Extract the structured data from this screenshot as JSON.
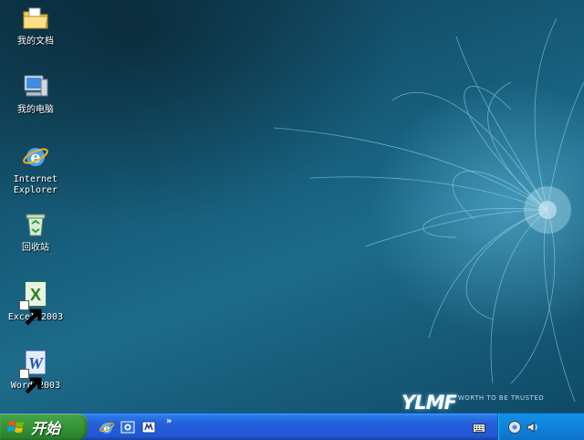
{
  "desktop": {
    "icons": [
      {
        "name": "my-documents",
        "label": "我的文档",
        "icon": "folder-with-documents-icon"
      },
      {
        "name": "my-computer",
        "label": "我的电脑",
        "icon": "computer-icon"
      },
      {
        "name": "internet-explorer",
        "label": "Internet\nExplorer",
        "icon": "internet-explorer-icon"
      },
      {
        "name": "recycle-bin",
        "label": "回收站",
        "icon": "recycle-bin-icon"
      },
      {
        "name": "excel-2003",
        "label": "Excel 2003",
        "icon": "excel-icon",
        "shortcut": true
      },
      {
        "name": "word-2003",
        "label": "Word 2003",
        "icon": "word-icon",
        "shortcut": true
      }
    ],
    "brand": {
      "logo": "YLMF",
      "slogan": "WORTH TO BE TRUSTED"
    }
  },
  "taskbar": {
    "start_label": "开始",
    "quick_launch": [
      {
        "name": "internet-explorer",
        "icon": "internet-explorer-icon"
      },
      {
        "name": "show-desktop",
        "icon": "show-desktop-icon"
      },
      {
        "name": "media-player",
        "icon": "media-player-icon"
      }
    ],
    "quick_launch_more": "»",
    "tray": {
      "icons": [
        "keyboard-icon",
        "network-icon",
        "volume-icon"
      ],
      "clock": ""
    }
  },
  "colors": {
    "taskbar_blue": "#245edb",
    "start_green": "#3c9b3f",
    "tray_blue": "#0f86e0",
    "desktop_teal": "#17607e"
  }
}
